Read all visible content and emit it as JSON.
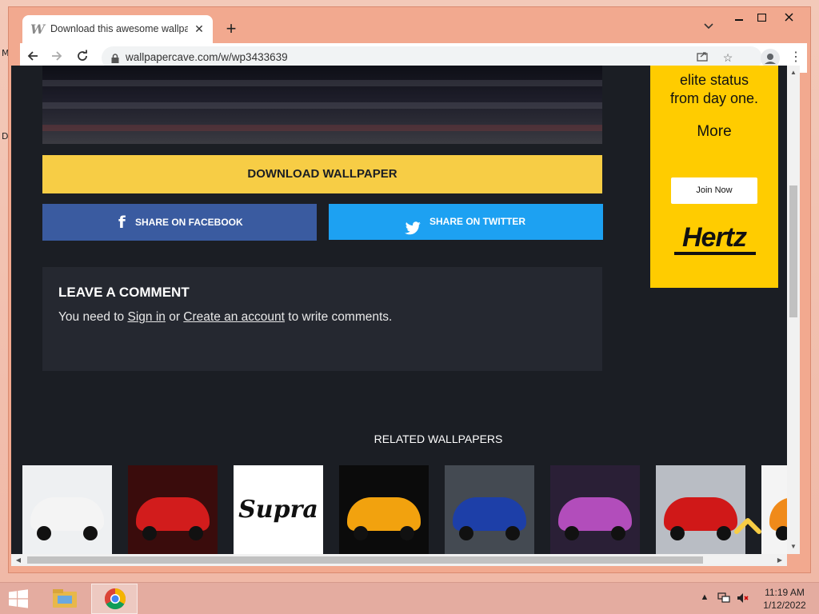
{
  "browser": {
    "tab_title": "Download this awesome wallpaper",
    "tab_close": "✕",
    "new_tab": "+",
    "url": "wallpapercave.com/w/wp3433639"
  },
  "page": {
    "download_label": "DOWNLOAD WALLPAPER",
    "share_facebook": "SHARE ON FACEBOOK",
    "share_twitter": "SHARE ON TWITTER",
    "comment": {
      "heading": "LEAVE A COMMENT",
      "prefix": "You need to ",
      "sign_in": "Sign in",
      "or": " or ",
      "create": "Create an account",
      "suffix": " to write comments."
    },
    "related_heading": "RELATED WALLPAPERS",
    "related": [
      {
        "name": "white-supra-rear",
        "bg": "#eef0f2",
        "car": "#f4f4f4"
      },
      {
        "name": "red-neon-supra",
        "bg": "#3a0c0c",
        "car": "#d21c1c"
      },
      {
        "name": "supra-logo",
        "bg": "#ffffff",
        "car": "#111111"
      },
      {
        "name": "orange-supra-dark",
        "bg": "#0b0b0b",
        "car": "#f2a20e"
      },
      {
        "name": "blue-supra-garage",
        "bg": "#444a52",
        "car": "#1d3fa8"
      },
      {
        "name": "purple-supra-wings",
        "bg": "#2a1f36",
        "car": "#b24dbb"
      },
      {
        "name": "red-supra-compact",
        "bg": "#b9bdc4",
        "car": "#d01818"
      },
      {
        "name": "orange-supra-partial",
        "bg": "#f4f4f4",
        "car": "#f08a1a"
      }
    ]
  },
  "ad": {
    "line1": "elite status",
    "line2": "from day one.",
    "more": "More",
    "join": "Join Now",
    "brand": "Hertz"
  },
  "taskbar": {
    "time": "11:19 AM",
    "date": "1/12/2022"
  },
  "colors": {
    "download": "#f7cd45",
    "facebook": "#3a5ba0",
    "twitter": "#1da1f2",
    "ad_bg": "#ffcc00",
    "page_bg": "#1b1e24"
  }
}
